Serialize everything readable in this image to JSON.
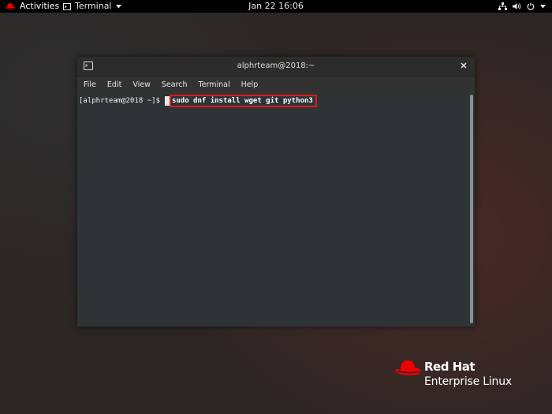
{
  "topbar": {
    "activities_label": "Activities",
    "app_menu_label": "Terminal",
    "clock": "Jan 22  16:06",
    "icons": [
      "redhat-logo-icon",
      "terminal-icon",
      "chevron-down-icon",
      "network-icon",
      "volume-icon",
      "power-icon",
      "chevron-down-icon"
    ]
  },
  "terminal": {
    "title": "alphrteam@2018:~",
    "menu": [
      "File",
      "Edit",
      "View",
      "Search",
      "Terminal",
      "Help"
    ],
    "prompt": "[alphrteam@2018 ~]$",
    "command": "sudo dnf install wget git python3"
  },
  "branding": {
    "name": "Red Hat",
    "product": "Enterprise Linux"
  },
  "colors": {
    "accent_red": "#e01b1b",
    "terminal_bg": "#2e3436",
    "topbar_bg": "#000000",
    "redhat_red": "#ee0000"
  }
}
